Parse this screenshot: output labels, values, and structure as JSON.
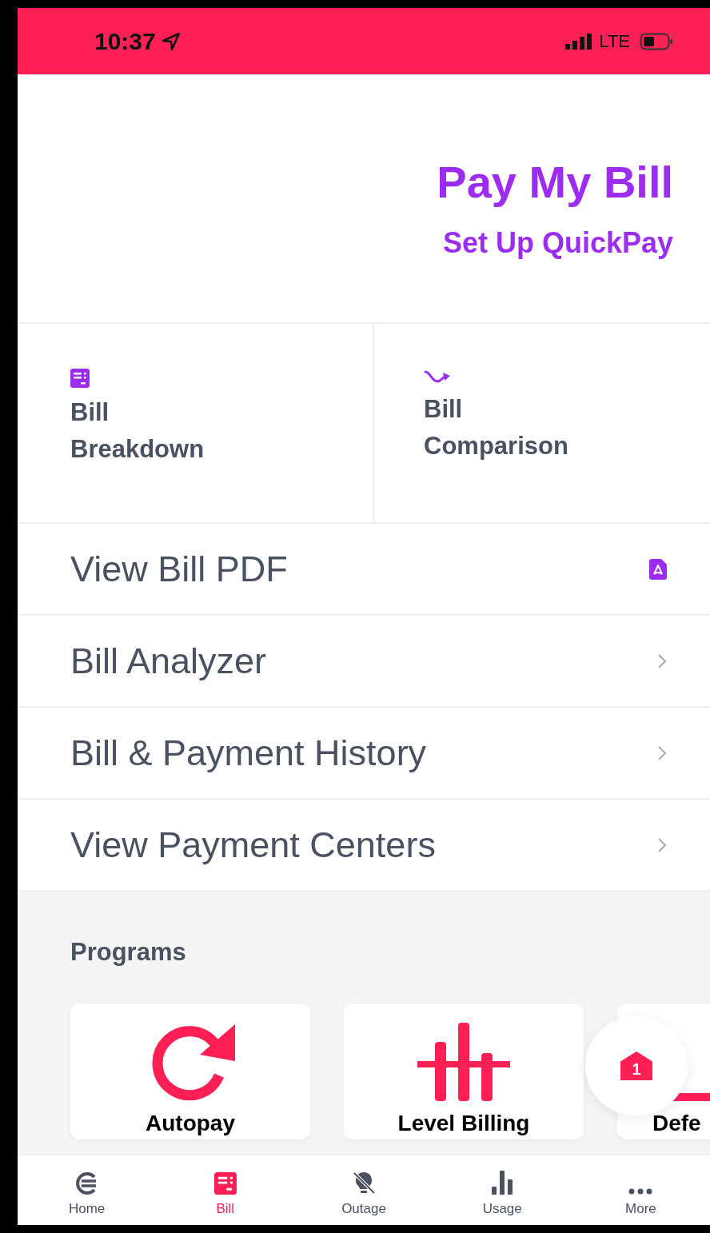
{
  "status_bar": {
    "time": "10:37",
    "network": "LTE"
  },
  "header": {
    "title": "Pay My Bill",
    "link": "Set Up QuickPay"
  },
  "tiles": [
    {
      "label": "Bill Breakdown",
      "kind": "bill"
    },
    {
      "label": "Bill Comparison",
      "kind": "trend"
    }
  ],
  "rows": [
    {
      "label": "View Bill PDF",
      "kind": "pdf"
    },
    {
      "label": "Bill Analyzer",
      "kind": "chevron"
    },
    {
      "label": "Bill & Payment History",
      "kind": "chevron"
    },
    {
      "label": "View Payment Centers",
      "kind": "chevron"
    }
  ],
  "programs": {
    "title": "Programs",
    "cards": [
      {
        "label": "Autopay",
        "kind": "refresh"
      },
      {
        "label": "Level Billing",
        "kind": "sliders"
      },
      {
        "label": "Defe",
        "kind": "frame"
      }
    ]
  },
  "floating_button": {
    "badge": "1"
  },
  "tabs": [
    {
      "label": "Home",
      "kind": "home",
      "selected": false
    },
    {
      "label": "Bill",
      "kind": "bill",
      "selected": true
    },
    {
      "label": "Outage",
      "kind": "bulb",
      "selected": false
    },
    {
      "label": "Usage",
      "kind": "bars",
      "selected": false
    },
    {
      "label": "More",
      "kind": "dots",
      "selected": false
    }
  ]
}
